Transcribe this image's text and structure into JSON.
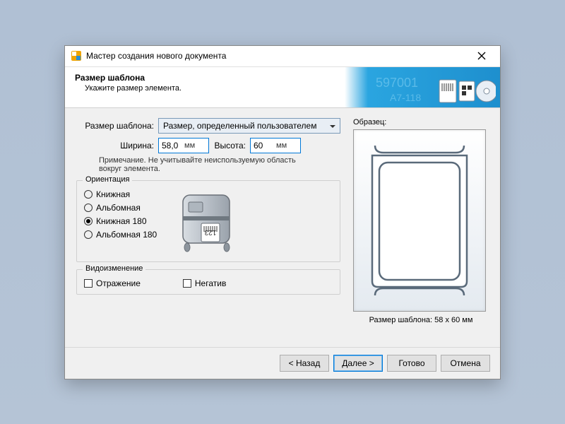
{
  "window": {
    "title": "Мастер создания нового документа"
  },
  "header": {
    "title": "Размер шаблона",
    "subtitle": "Укажите размер элемента."
  },
  "form": {
    "size_label": "Размер шаблона:",
    "size_select_value": "Размер, определенный пользователем",
    "width_label": "Ширина:",
    "width_value": "58,0",
    "width_unit": "мм",
    "height_label": "Высота:",
    "height_value": "60",
    "height_unit": "мм",
    "note": "Примечание. Не учитывайте неиспользуемую область вокруг элемента."
  },
  "orientation": {
    "legend": "Ориентация",
    "options": [
      {
        "label": "Книжная",
        "selected": false
      },
      {
        "label": "Альбомная",
        "selected": false
      },
      {
        "label": "Книжная 180",
        "selected": true
      },
      {
        "label": "Альбомная 180",
        "selected": false
      }
    ]
  },
  "effects": {
    "legend": "Видоизменение",
    "mirror_label": "Отражение",
    "negative_label": "Негатив"
  },
  "sample": {
    "label": "Образец:",
    "caption": "Размер шаблона:  58 x 60 мм"
  },
  "buttons": {
    "back": "<  Назад",
    "next": "Далее  >",
    "finish": "Готово",
    "cancel": "Отмена"
  }
}
